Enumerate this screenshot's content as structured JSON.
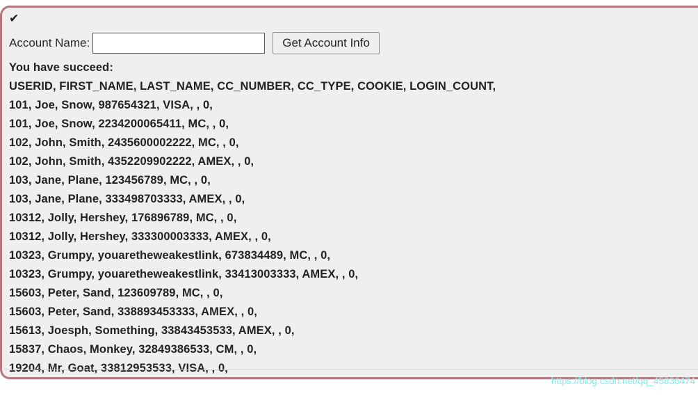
{
  "panel": {
    "status_icon": "check-icon",
    "status_glyph": "✔",
    "border_color": "#b5777f",
    "background_color": "#efefef"
  },
  "form": {
    "label": "Account Name:",
    "input_value": "",
    "input_placeholder": "",
    "submit_label": "Get Account Info"
  },
  "results": {
    "status_message": "You have succeed:",
    "header_line": "USERID, FIRST_NAME, LAST_NAME, CC_NUMBER, CC_TYPE, COOKIE, LOGIN_COUNT,",
    "columns": [
      "USERID",
      "FIRST_NAME",
      "LAST_NAME",
      "CC_NUMBER",
      "CC_TYPE",
      "COOKIE",
      "LOGIN_COUNT"
    ],
    "rows": [
      {
        "userid": "101",
        "first_name": "Joe",
        "last_name": "Snow",
        "cc_number": "987654321",
        "cc_type": "VISA",
        "cookie": "",
        "login_count": "0",
        "text": "101, Joe, Snow, 987654321, VISA, , 0,"
      },
      {
        "userid": "101",
        "first_name": "Joe",
        "last_name": "Snow",
        "cc_number": "2234200065411",
        "cc_type": "MC",
        "cookie": "",
        "login_count": "0",
        "text": "101, Joe, Snow, 2234200065411, MC, , 0,"
      },
      {
        "userid": "102",
        "first_name": "John",
        "last_name": "Smith",
        "cc_number": "2435600002222",
        "cc_type": "MC",
        "cookie": "",
        "login_count": "0",
        "text": "102, John, Smith, 2435600002222, MC, , 0,"
      },
      {
        "userid": "102",
        "first_name": "John",
        "last_name": "Smith",
        "cc_number": "4352209902222",
        "cc_type": "AMEX",
        "cookie": "",
        "login_count": "0",
        "text": "102, John, Smith, 4352209902222, AMEX, , 0,"
      },
      {
        "userid": "103",
        "first_name": "Jane",
        "last_name": "Plane",
        "cc_number": "123456789",
        "cc_type": "MC",
        "cookie": "",
        "login_count": "0",
        "text": "103, Jane, Plane, 123456789, MC, , 0,"
      },
      {
        "userid": "103",
        "first_name": "Jane",
        "last_name": "Plane",
        "cc_number": "333498703333",
        "cc_type": "AMEX",
        "cookie": "",
        "login_count": "0",
        "text": "103, Jane, Plane, 333498703333, AMEX, , 0,"
      },
      {
        "userid": "10312",
        "first_name": "Jolly",
        "last_name": "Hershey",
        "cc_number": "176896789",
        "cc_type": "MC",
        "cookie": "",
        "login_count": "0",
        "text": "10312, Jolly, Hershey, 176896789, MC, , 0,"
      },
      {
        "userid": "10312",
        "first_name": "Jolly",
        "last_name": "Hershey",
        "cc_number": "333300003333",
        "cc_type": "AMEX",
        "cookie": "",
        "login_count": "0",
        "text": "10312, Jolly, Hershey, 333300003333, AMEX, , 0,"
      },
      {
        "userid": "10323",
        "first_name": "Grumpy",
        "last_name": "youaretheweakestlink",
        "cc_number": "673834489",
        "cc_type": "MC",
        "cookie": "",
        "login_count": "0",
        "text": "10323, Grumpy, youaretheweakestlink, 673834489, MC, , 0,"
      },
      {
        "userid": "10323",
        "first_name": "Grumpy",
        "last_name": "youaretheweakestlink",
        "cc_number": "33413003333",
        "cc_type": "AMEX",
        "cookie": "",
        "login_count": "0",
        "text": "10323, Grumpy, youaretheweakestlink, 33413003333, AMEX, , 0,"
      },
      {
        "userid": "15603",
        "first_name": "Peter",
        "last_name": "Sand",
        "cc_number": "123609789",
        "cc_type": "MC",
        "cookie": "",
        "login_count": "0",
        "text": "15603, Peter, Sand, 123609789, MC, , 0,"
      },
      {
        "userid": "15603",
        "first_name": "Peter",
        "last_name": "Sand",
        "cc_number": "338893453333",
        "cc_type": "AMEX",
        "cookie": "",
        "login_count": "0",
        "text": "15603, Peter, Sand, 338893453333, AMEX, , 0,"
      },
      {
        "userid": "15613",
        "first_name": "Joesph",
        "last_name": "Something",
        "cc_number": "33843453533",
        "cc_type": "AMEX",
        "cookie": "",
        "login_count": "0",
        "text": "15613, Joesph, Something, 33843453533, AMEX, , 0,"
      },
      {
        "userid": "15837",
        "first_name": "Chaos",
        "last_name": "Monkey",
        "cc_number": "32849386533",
        "cc_type": "CM",
        "cookie": "",
        "login_count": "0",
        "text": "15837, Chaos, Monkey, 32849386533, CM, , 0,"
      },
      {
        "userid": "19204",
        "first_name": "Mr",
        "last_name": "Goat",
        "cc_number": "33812953533",
        "cc_type": "VISA",
        "cookie": "",
        "login_count": "0",
        "text": "19204, Mr, Goat, 33812953533, VISA, , 0,"
      }
    ]
  },
  "watermark": {
    "text": "https://blog.csdn.net/qq_45836474",
    "color": "#7ff0ef"
  }
}
